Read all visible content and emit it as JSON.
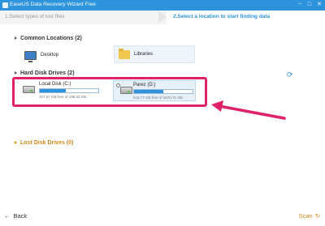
{
  "window": {
    "title": "EaseUS Data Recovery Wizard Free",
    "controls": [
      "−",
      "□",
      "✕"
    ]
  },
  "steps": {
    "step1": "1.Select types of lost files",
    "step2": "2.Select a location to start finding data"
  },
  "common_locations": {
    "header": "Common Locations (2)",
    "items": [
      {
        "label": "Desktop",
        "icon": "desktop-icon"
      },
      {
        "label": "Libraries",
        "icon": "folder-icon"
      }
    ]
  },
  "hard_disk_drives": {
    "header": "Hard Disk Drives (2)",
    "drives": [
      {
        "name": "Local Disk (C:)",
        "free": "107.57 GB free of 195.32 GB",
        "used_fraction": 0.45,
        "icon": "hdd-icon"
      },
      {
        "name": "Parez (D:)",
        "free": "843.77 GB free of 1670.71 GB",
        "used_fraction": 0.5,
        "icon": "hdd-icon"
      }
    ]
  },
  "lost_disk_drives": {
    "header": "Lost Disk Drives (0)"
  },
  "footer": {
    "back_label": "Back",
    "scan_label": "Scan"
  },
  "colors": {
    "accent": "#2c93dc",
    "highlight": "#e0226b",
    "orange": "#d28a1a"
  }
}
